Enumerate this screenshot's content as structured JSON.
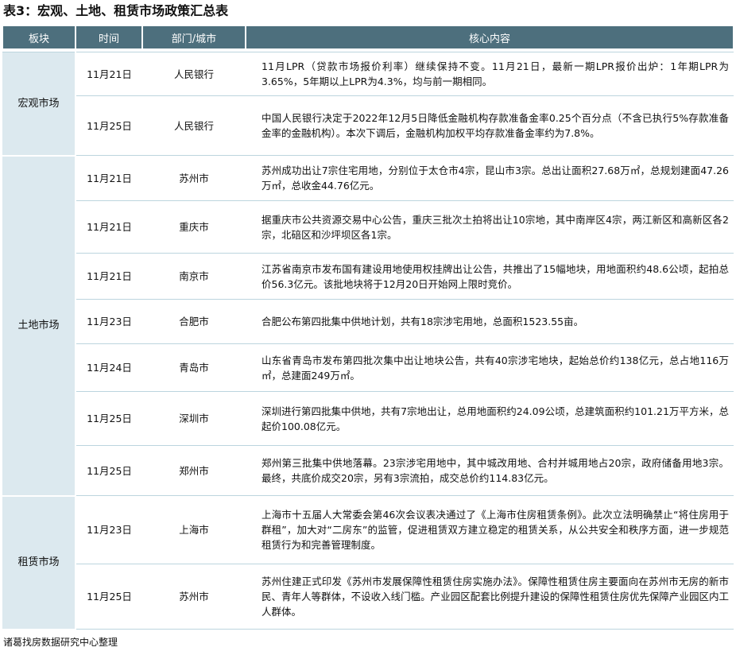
{
  "title": "表3：宏观、土地、租赁市场政策汇总表",
  "headers": {
    "sector": "板块",
    "time": "时间",
    "dept": "部门/城市",
    "content": "核心内容"
  },
  "sections": [
    {
      "name": "宏观市场",
      "rows": [
        {
          "date": "11月21日",
          "dept": "人民银行",
          "content": "11月LPR（贷款市场报价利率）继续保持不变。11月21日，最新一期LPR报价出炉：1年期LPR为3.65%，5年期以上LPR为4.3%，均与前一期相同。"
        },
        {
          "date": "11月25日",
          "dept": "人民银行",
          "content": "中国人民银行决定于2022年12月5日降低金融机构存款准备金率0.25个百分点（不含已执行5%存款准备金率的金融机构）。本次下调后，金融机构加权平均存款准备金率约为7.8%。"
        }
      ]
    },
    {
      "name": "土地市场",
      "rows": [
        {
          "date": "11月21日",
          "dept": "苏州市",
          "content": "苏州成功出让7宗住宅用地，分别位于太仓市4宗，昆山市3宗。总出让面积27.68万㎡，总规划建面47.26万㎡，总收金44.76亿元。"
        },
        {
          "date": "11月21日",
          "dept": "重庆市",
          "content": "据重庆市公共资源交易中心公告，重庆三批次土拍将出让10宗地，其中南岸区4宗，两江新区和高新区各2宗，北碚区和沙坪坝区各1宗。"
        },
        {
          "date": "11月21日",
          "dept": "南京市",
          "content": "江苏省南京市发布国有建设用地使用权挂牌出让公告，共推出了15幅地块，用地面积约48.6公顷，起拍总价56.3亿元。该批地块将于12月20日开始网上限时竞价。"
        },
        {
          "date": "11月23日",
          "dept": "合肥市",
          "content": "合肥公布第四批集中供地计划，共有18宗涉宅用地，总面积1523.55亩。"
        },
        {
          "date": "11月24日",
          "dept": "青岛市",
          "content": "山东省青岛市发布第四批次集中出让地块公告，共有40宗涉宅地块，起始总价约138亿元，总占地116万㎡，总建面249万㎡。"
        },
        {
          "date": "11月25日",
          "dept": "深圳市",
          "content": "深圳进行第四批集中供地，共有7宗地出让，总用地面积约24.09公顷，总建筑面积约101.21万平方米，总起价100.08亿元。"
        },
        {
          "date": "11月25日",
          "dept": "郑州市",
          "content": "郑州第三批集中供地落幕。23宗涉宅用地中，其中城改用地、合村并城用地占20宗，政府储备用地3宗。最终，共底价成交20宗，另有3宗流拍，成交总价约114.83亿元。"
        }
      ]
    },
    {
      "name": "租赁市场",
      "rows": [
        {
          "date": "11月23日",
          "dept": "上海市",
          "content": "上海市十五届人大常委会第46次会议表决通过了《上海市住房租赁条例》。此次立法明确禁止“将住房用于群租”，加大对“二房东”的监管，促进租赁双方建立稳定的租赁关系，从公共安全和秩序方面，进一步规范租赁行为和完善管理制度。"
        },
        {
          "date": "11月25日",
          "dept": "苏州市",
          "content": "苏州住建正式印发《苏州市发展保障性租赁住房实施办法》。保障性租赁住房主要面向在苏州市无房的新市民、青年人等群体，不设收入线门槛。产业园区配套比例提升建设的保障性租赁住房优先保障产业园区内工人群体。"
        }
      ]
    }
  ],
  "footer": "诸葛找房数据研究中心整理",
  "colors": {
    "header_bg": "#4d6f7d",
    "section_bg": "#dce9ef",
    "row_line": "#bcd5de"
  }
}
